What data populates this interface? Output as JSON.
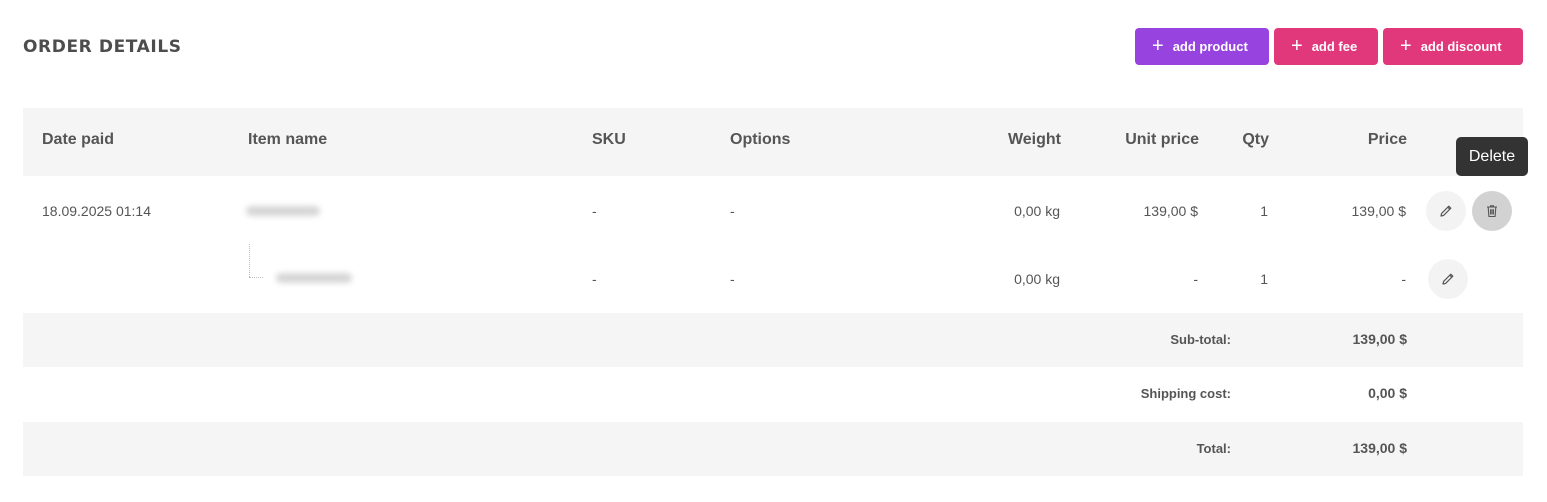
{
  "header": {
    "title": "ORDER DETAILS"
  },
  "buttons": {
    "add_product": "add product",
    "add_fee": "add fee",
    "add_discount": "add discount",
    "plus": "+",
    "colors": {
      "product": "#9743e0",
      "fee": "#e0387a",
      "discount": "#e0387a"
    }
  },
  "table": {
    "columns": [
      "Date paid",
      "Item name",
      "SKU",
      "Options",
      "Weight",
      "Unit price",
      "Qty",
      "Price"
    ],
    "rows": [
      {
        "date": "18.09.2025 01:14",
        "sku": "-",
        "options": "-",
        "weight": "0,00 kg",
        "unit_price": "139,00 $",
        "qty": "1",
        "price": "139,00 $",
        "actions": [
          "pencil-icon",
          "trash-icon"
        ]
      },
      {
        "sku": "-",
        "options": "-",
        "weight": "0,00 kg",
        "unit_price": "-",
        "qty": "1",
        "price": "-",
        "actions": [
          "pencil-icon"
        ]
      }
    ]
  },
  "tooltip": {
    "text": "Delete"
  },
  "totals": {
    "subtotal_label": "Sub-total:",
    "subtotal_value": "139,00 $",
    "shipping_label": "Shipping cost:",
    "shipping_value": "0,00 $",
    "total_label": "Total:",
    "total_value": "139,00 $"
  }
}
